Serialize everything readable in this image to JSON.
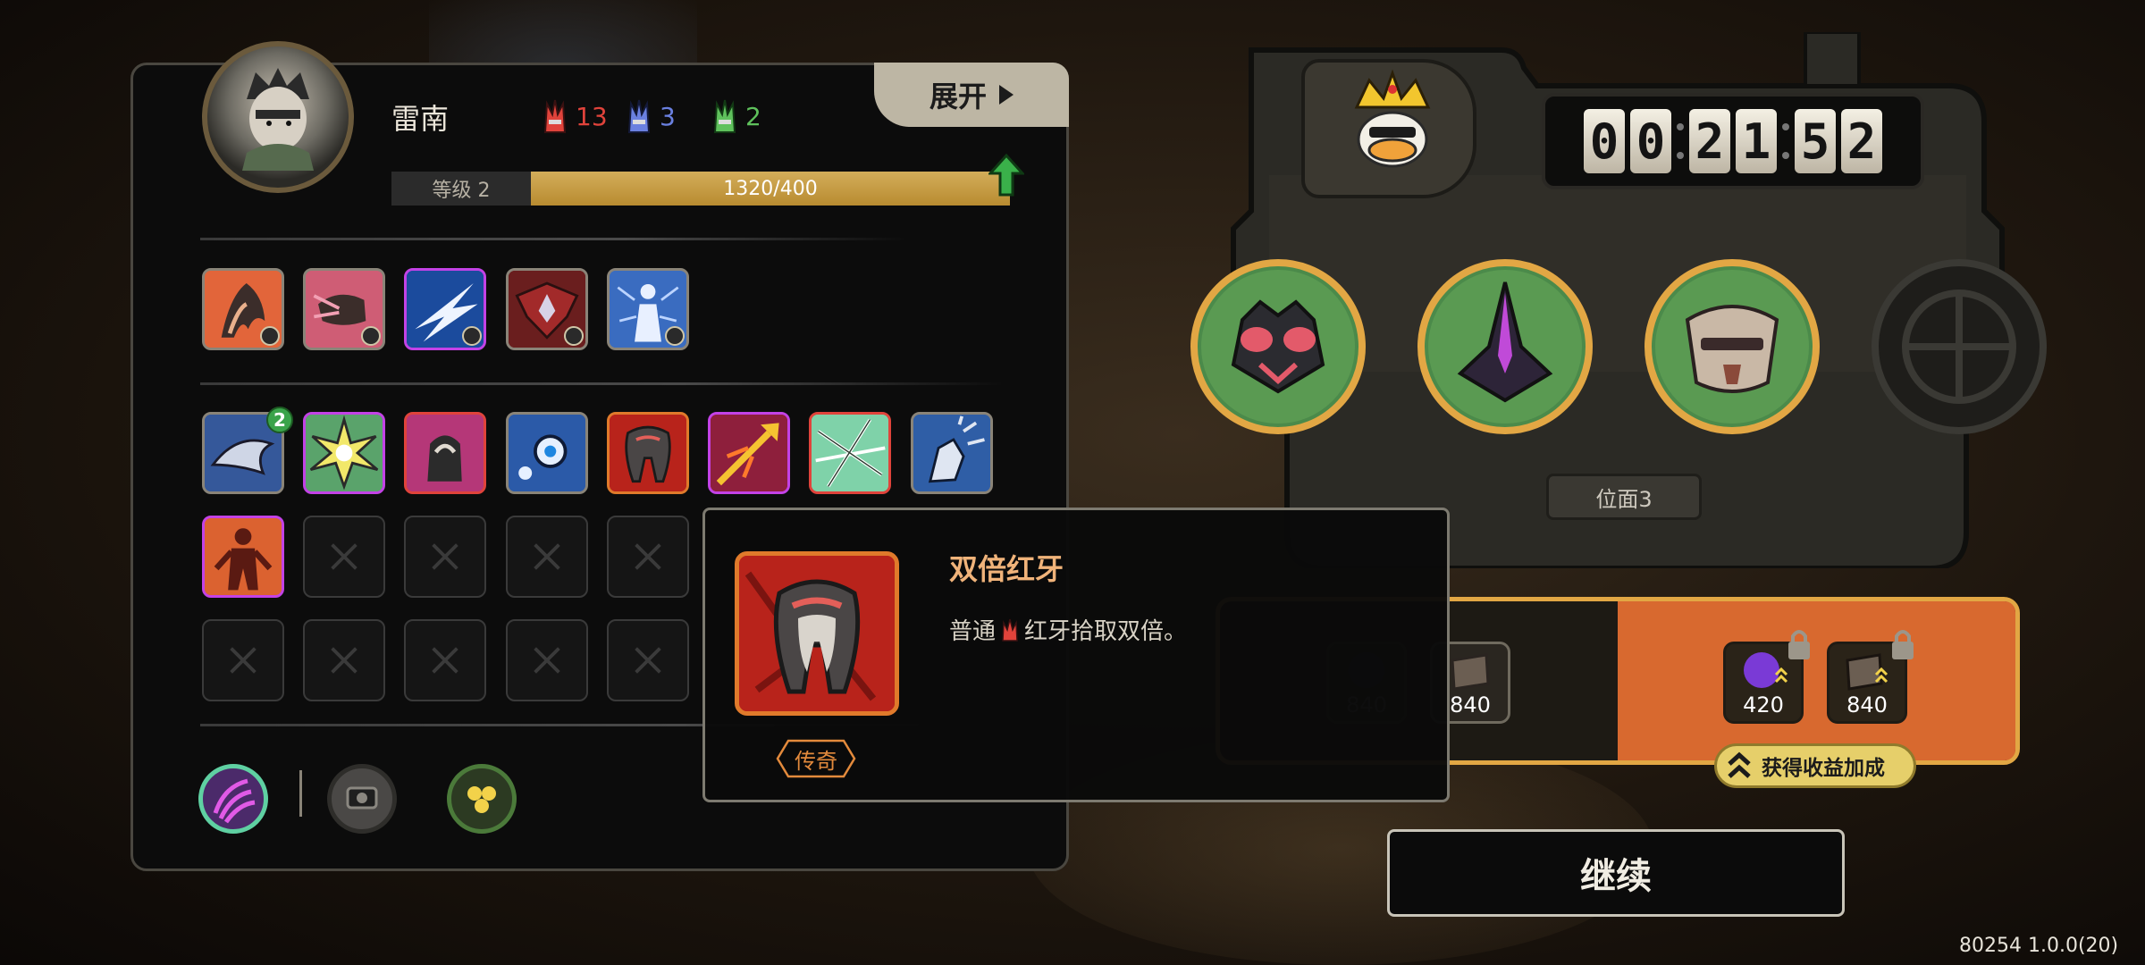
{
  "player": {
    "name": "雷南",
    "level_label": "等级 2",
    "xp_text": "1320/400",
    "xp_fill_fraction": 1.0
  },
  "resources": [
    {
      "icon": "red-horn-icon",
      "value": "13",
      "color": "#e0433b"
    },
    {
      "icon": "blue-horn-icon",
      "value": "3",
      "color": "#6a80e0"
    },
    {
      "icon": "green-horn-icon",
      "value": "2",
      "color": "#5fc15c"
    }
  ],
  "expand_button": {
    "label": "展开"
  },
  "equipped_skill_icons": [
    "fire-claw-icon",
    "pink-fist-icon",
    "lightning-slash-icon",
    "crimson-shield-icon",
    "glowing-figure-icon"
  ],
  "passive_skill_icons": [
    "shark-icon",
    "burst-icon",
    "fist-grip-icon",
    "eye-orb-icon",
    "red-fang-icon",
    "flaming-arrow-icon",
    "shatter-icon",
    "finger-snap-icon",
    "red-demon-icon"
  ],
  "passive_badge": "2",
  "bottom_icons": [
    "purple-claw-icon",
    "gear-chip-icon",
    "spore-icon"
  ],
  "tooltip": {
    "title": "双倍红牙",
    "desc_prefix": "普通",
    "desc_suffix": "红牙拾取双倍。",
    "rarity": "传奇",
    "icon": "red-fang-icon"
  },
  "timer": {
    "digits": [
      "0",
      "0",
      "2",
      "1",
      "5",
      "2"
    ]
  },
  "king_icon": "crowned-duck-icon",
  "bosses": [
    "pink-bug-boss-icon",
    "purple-horn-boss-icon",
    "armored-mask-boss-icon",
    "empty-boss-slot-icon"
  ],
  "plane_label": "位面3",
  "rewards": {
    "dim_items": [
      {
        "icon": "purple-orb-icon",
        "value": "840"
      },
      {
        "icon": "book-icon",
        "value": "840"
      }
    ],
    "bonus_items": [
      {
        "icon": "purple-orb-icon",
        "value": "420"
      },
      {
        "icon": "book-icon",
        "value": "840"
      }
    ],
    "bonus_label": "获得收益加成"
  },
  "continue_label": "继续",
  "version": "80254 1.0.0(20)"
}
